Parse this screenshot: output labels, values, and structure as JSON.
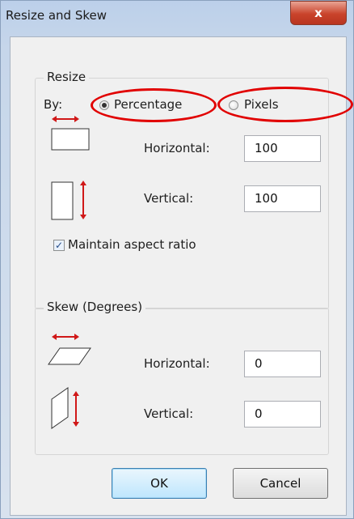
{
  "window": {
    "title": "Resize and Skew",
    "close_label": "x"
  },
  "resize": {
    "group_title": "Resize",
    "by_label": "By:",
    "percentage_label": "Percentage",
    "pixels_label": "Pixels",
    "selected": "Percentage",
    "horizontal_label": "Horizontal:",
    "horizontal_value": "100",
    "vertical_label": "Vertical:",
    "vertical_value": "100",
    "maintain_label": "Maintain aspect ratio",
    "maintain_checked": true
  },
  "skew": {
    "group_title": "Skew (Degrees)",
    "horizontal_label": "Horizontal:",
    "horizontal_value": "0",
    "vertical_label": "Vertical:",
    "vertical_value": "0"
  },
  "buttons": {
    "ok": "OK",
    "cancel": "Cancel"
  },
  "colors": {
    "annotation": "#e10000",
    "arrow": "#d01818"
  }
}
